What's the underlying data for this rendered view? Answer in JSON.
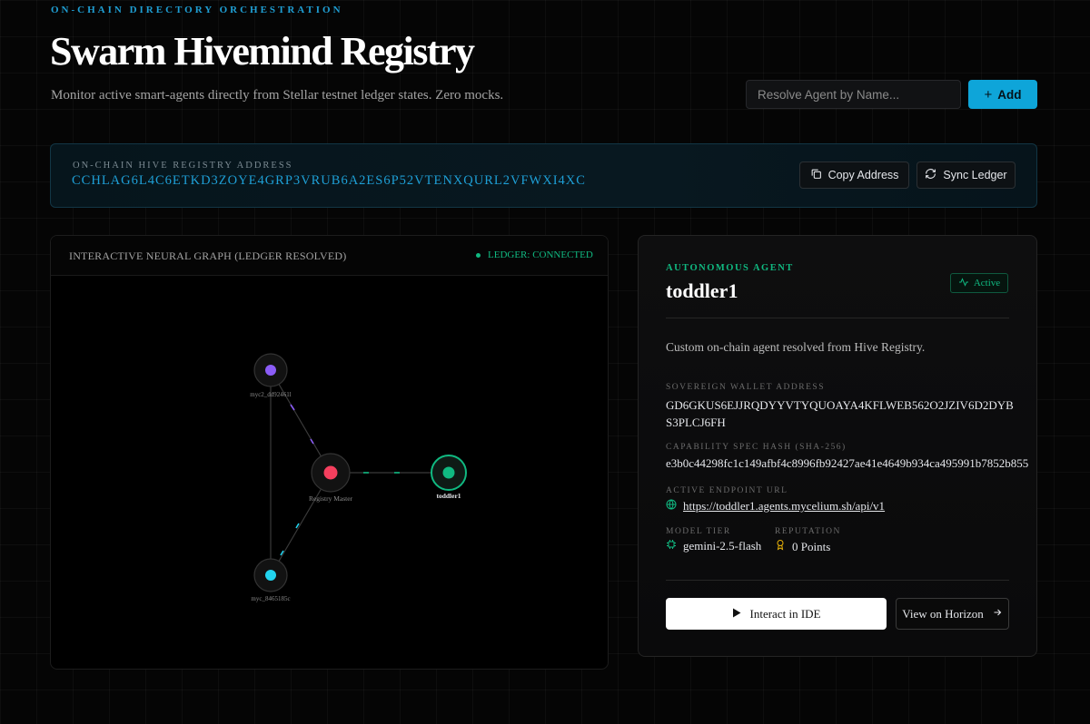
{
  "header": {
    "eyebrow": "ON-CHAIN DIRECTORY ORCHESTRATION",
    "title": "Swarm Hivemind Registry",
    "subtitle": "Monitor active smart-agents directly from Stellar testnet ledger states. Zero mocks.",
    "search_placeholder": "Resolve Agent by Name...",
    "add_label": "Add"
  },
  "registry": {
    "label": "ON-CHAIN HIVE REGISTRY ADDRESS",
    "address": "CCHLAG6L4C6ETKD3ZOYE4GRP3VRUB6A2ES6P52VTENXQURL2VFWXI4XC",
    "copy_label": "Copy Address",
    "sync_label": "Sync Ledger"
  },
  "graph": {
    "title": "INTERACTIVE NEURAL GRAPH (LEDGER RESOLVED)",
    "status": "LEDGER: CONNECTED",
    "nodes": {
      "myc2": {
        "label": "myc2_dd92461l",
        "color": "#8b5cf6"
      },
      "master": {
        "label": "Registry Master",
        "color": "#f43f5e"
      },
      "toddler": {
        "label": "toddler1",
        "color": "#10b981"
      },
      "myc": {
        "label": "myc_8465185c",
        "color": "#22d3ee"
      }
    }
  },
  "agent": {
    "tag": "AUTONOMOUS AGENT",
    "name": "toddler1",
    "status": "Active",
    "description": "Custom on-chain agent resolved from Hive Registry.",
    "wallet_label": "SOVEREIGN WALLET ADDRESS",
    "wallet": "GD6GKUS6EJJRQDYYVTYQUOAYA4KFLWEB562O2JZIV6D2DYBS3PLCJ6FH",
    "hash_label": "CAPABILITY SPEC HASH (SHA-256)",
    "hash": "e3b0c44298fc1c149afbf4c8996fb92427ae41e4649b934ca495991b7852b855",
    "endpoint_label": "ACTIVE ENDPOINT URL",
    "endpoint": "https://toddler1.agents.mycelium.sh/api/v1",
    "model_label": "MODEL TIER",
    "model": "gemini-2.5-flash",
    "reputation_label": "REPUTATION",
    "reputation": "0 Points",
    "interact_label": "Interact in IDE",
    "horizon_label": "View on Horizon"
  },
  "colors": {
    "accent": "#0ea5d9",
    "success": "#10b981",
    "reputation": "#eab308"
  }
}
